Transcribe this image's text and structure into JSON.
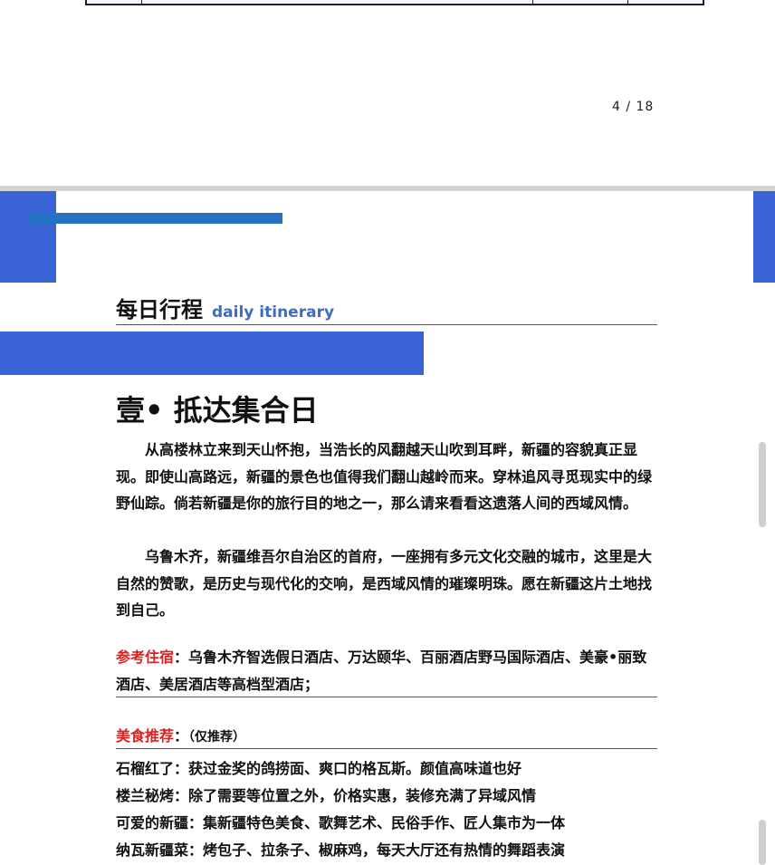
{
  "page_number": "4 / 18",
  "section": {
    "title_zh": "每日行程",
    "title_en": "daily itinerary"
  },
  "day_title": "壹• 抵达集合日",
  "paragraphs": [
    "从高楼林立来到天山怀抱，当浩长的风翻越天山吹到耳畔，新疆的容貌真正显现。即使山高路远，新疆的景色也值得我们翻山越岭而来。穿林追风寻觅现实中的绿野仙踪。倘若新疆是你的旅行目的地之一，那么请来看看这遗落人间的西域风情。",
    "乌鲁木齐，新疆维吾尔自治区的首府，一座拥有多元文化交融的城市，这里是大自然的赞歌，是历史与现代化的交响，是西域风情的璀璨明珠。愿在新疆这片土地找到自己。"
  ],
  "hotel": {
    "label": "参考住宿",
    "text": "：乌鲁木齐智选假日酒店、万达颐华、百丽酒店野马国际酒店、美豪•丽致酒店、美居酒店等高档型酒店；"
  },
  "food": {
    "label": "美食推荐",
    "colon": "：",
    "note": "（仅推荐）",
    "items": [
      "石榴红了：获过金奖的鸽捞面、爽口的格瓦斯。颜值高味道也好",
      "楼兰秘烤：除了需要等位置之外，价格实惠，装修充满了异域风情",
      "可爱的新疆：集新疆特色美食、歌舞艺术、民俗手作、匠人集市为一体",
      "纳瓦新疆菜：烤包子、拉条子、椒麻鸡，每天大厅还有热情的舞蹈表演"
    ]
  },
  "colors": {
    "accent_blue": "#3a63d6",
    "bar_blue": "#2472c4",
    "label_red": "#e02020",
    "title_en": "#3d6cc2"
  }
}
